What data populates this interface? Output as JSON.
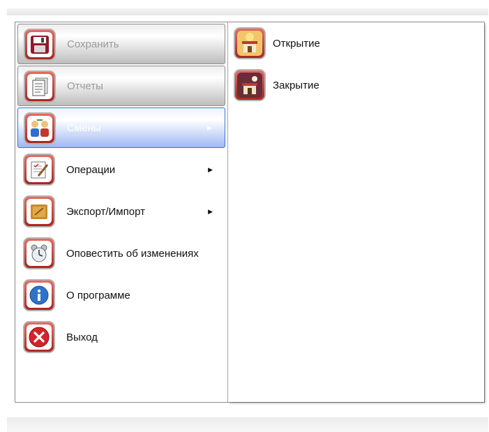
{
  "menu": {
    "items": [
      {
        "label": "Сохранить",
        "state": "disabled",
        "icon": "save-icon"
      },
      {
        "label": "Отчеты",
        "state": "disabled",
        "icon": "reports-icon"
      },
      {
        "label": "Смены",
        "state": "selected",
        "icon": "shifts-icon",
        "submenu": true
      },
      {
        "label": "Операции",
        "state": "normal",
        "icon": "operations-icon",
        "submenu": true
      },
      {
        "label": "Экспорт/Импорт",
        "state": "normal",
        "icon": "export-import-icon",
        "submenu": true
      },
      {
        "label": "Оповестить об изменениях",
        "state": "normal",
        "icon": "notify-icon"
      },
      {
        "label": "О программе",
        "state": "normal",
        "icon": "info-icon"
      },
      {
        "label": "Выход",
        "state": "normal",
        "icon": "exit-icon"
      }
    ],
    "submenu_arrow": "▶"
  },
  "submenu": {
    "items": [
      {
        "label": "Открытие",
        "icon": "shift-open-icon"
      },
      {
        "label": "Закрытие",
        "icon": "shift-close-icon"
      }
    ]
  },
  "colors": {
    "icon_red": "#c0392b",
    "selection_blue": "#3b6fd9"
  }
}
